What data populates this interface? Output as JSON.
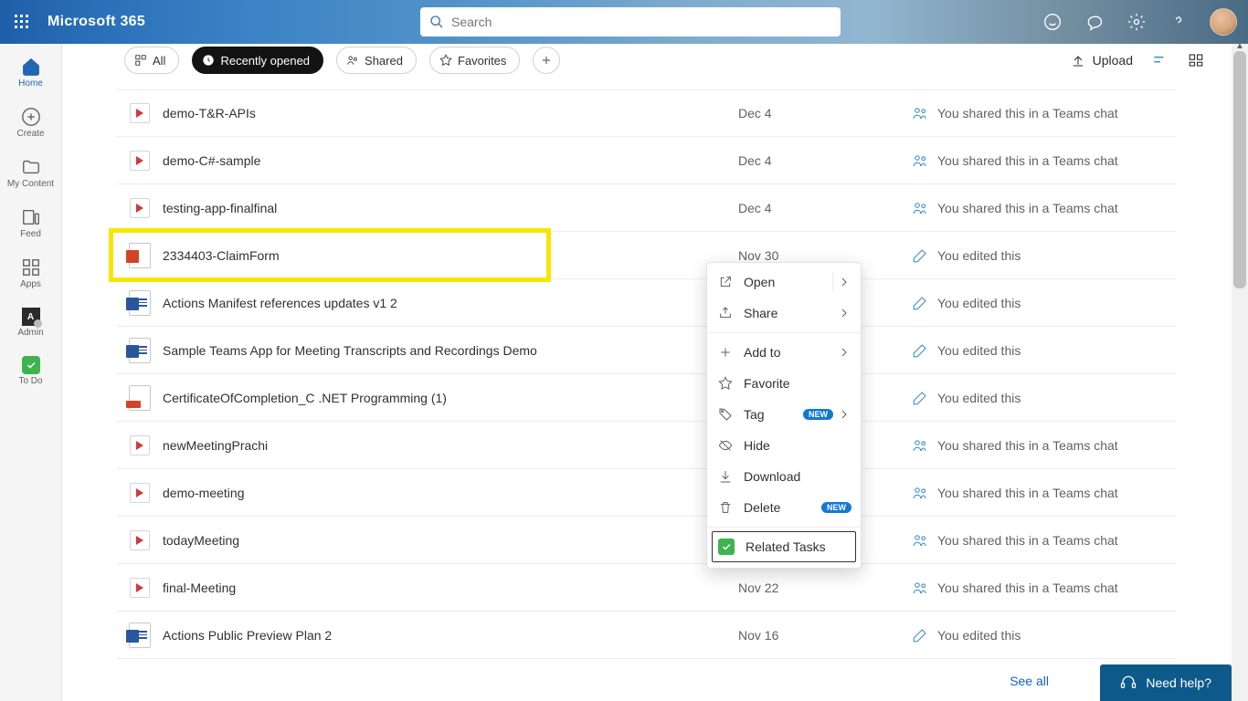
{
  "header": {
    "brand": "Microsoft 365",
    "searchPlaceholder": "Search"
  },
  "rail": [
    {
      "key": "home",
      "label": "Home"
    },
    {
      "key": "create",
      "label": "Create"
    },
    {
      "key": "mycontent",
      "label": "My Content"
    },
    {
      "key": "feed",
      "label": "Feed"
    },
    {
      "key": "apps",
      "label": "Apps"
    },
    {
      "key": "admin",
      "label": "Admin"
    },
    {
      "key": "todo",
      "label": "To Do"
    }
  ],
  "filters": {
    "all": "All",
    "recent": "Recently opened",
    "shared": "Shared",
    "favorites": "Favorites",
    "upload": "Upload"
  },
  "files": [
    {
      "icon": "stream",
      "name": "demo-T&R-APIs",
      "date": "Dec 4",
      "share": "You shared this in a Teams chat",
      "shareIcon": "people"
    },
    {
      "icon": "stream",
      "name": "demo-C#-sample",
      "date": "Dec 4",
      "share": "You shared this in a Teams chat",
      "shareIcon": "people"
    },
    {
      "icon": "stream",
      "name": "testing-app-finalfinal",
      "date": "Dec 4",
      "share": "You shared this in a Teams chat",
      "shareIcon": "people"
    },
    {
      "icon": "ppt",
      "name": "2334403-ClaimForm",
      "date": "Nov 30",
      "share": "You edited this",
      "shareIcon": "edit",
      "highlight": true
    },
    {
      "icon": "word",
      "name": "Actions Manifest references updates v1 2",
      "date": "",
      "share": "You edited this",
      "shareIcon": "edit"
    },
    {
      "icon": "word",
      "name": "Sample Teams App for Meeting Transcripts and Recordings Demo",
      "date": "",
      "share": "You edited this",
      "shareIcon": "edit"
    },
    {
      "icon": "pdf",
      "name": "CertificateOfCompletion_C .NET Programming (1)",
      "date": "",
      "share": "You edited this",
      "shareIcon": "edit"
    },
    {
      "icon": "stream",
      "name": "newMeetingPrachi",
      "date": "",
      "share": "You shared this in a Teams chat",
      "shareIcon": "people"
    },
    {
      "icon": "stream",
      "name": "demo-meeting",
      "date": "",
      "share": "You shared this in a Teams chat",
      "shareIcon": "people"
    },
    {
      "icon": "stream",
      "name": "todayMeeting",
      "date": "",
      "share": "You shared this in a Teams chat",
      "shareIcon": "people"
    },
    {
      "icon": "stream",
      "name": "final-Meeting",
      "date": "Nov 22",
      "share": "You shared this in a Teams chat",
      "shareIcon": "people"
    },
    {
      "icon": "word",
      "name": "Actions Public Preview Plan 2",
      "date": "Nov 16",
      "share": "You edited this",
      "shareIcon": "edit"
    }
  ],
  "ctx": {
    "open": "Open",
    "share": "Share",
    "addto": "Add to",
    "favorite": "Favorite",
    "tag": "Tag",
    "hide": "Hide",
    "download": "Download",
    "delete": "Delete",
    "related": "Related Tasks",
    "new": "NEW"
  },
  "footer": {
    "seeAll": "See all",
    "help": "Need help?"
  }
}
